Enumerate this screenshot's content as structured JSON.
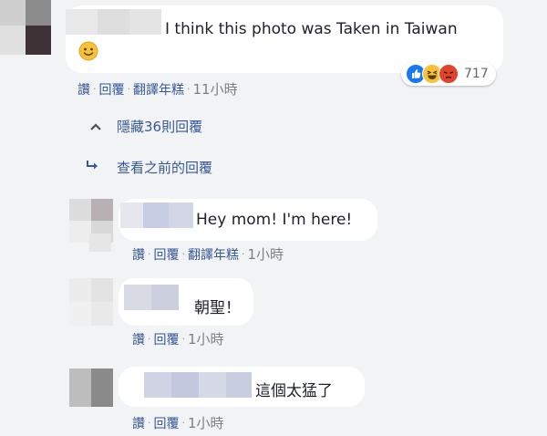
{
  "comments": [
    {
      "text": "I think this photo was Taken in Taiwan",
      "emoji": "🙂",
      "reaction_count": "717",
      "actions": {
        "like": "讚",
        "reply": "回覆",
        "translate": "翻譯年糕",
        "time": "11小時"
      }
    },
    {
      "text": "Hey mom! I'm here!",
      "actions": {
        "like": "讚",
        "reply": "回覆",
        "translate": "翻譯年糕",
        "time": "1小時"
      }
    },
    {
      "text": "朝聖！",
      "actions": {
        "like": "讚",
        "reply": "回覆",
        "time": "1小時"
      }
    },
    {
      "text": "這個太猛了",
      "actions": {
        "like": "讚",
        "reply": "回覆",
        "time": "1小時"
      }
    }
  ],
  "thread": {
    "hide_replies": "隱藏36則回覆",
    "view_previous": "查看之前的回覆"
  },
  "colors": {
    "link": "#365899",
    "background": "#f2f3f5",
    "bubble": "#ffffff",
    "like": "#1877f2",
    "haha": "#f7c23a",
    "angry": "#e0452b"
  },
  "icons": [
    "emoji-smile-icon",
    "like-reaction-icon",
    "haha-reaction-icon",
    "angry-reaction-icon",
    "chevron-up-icon",
    "reply-arrow-icon"
  ]
}
